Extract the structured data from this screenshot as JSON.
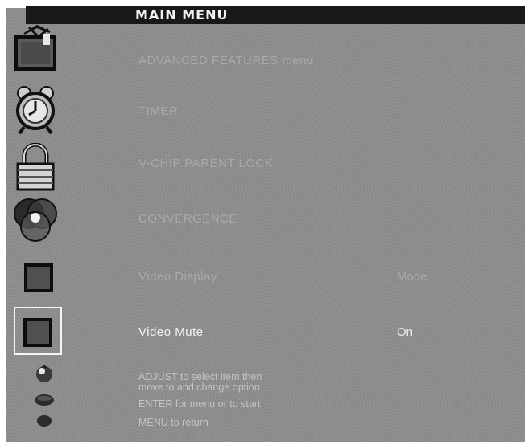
{
  "header": {
    "title": "MAIN MENU"
  },
  "menu": {
    "items": [
      {
        "label": "ADVANCED FEATURES menu",
        "icon": "tv-antenna-icon"
      },
      {
        "label": "TIMER",
        "icon": "alarm-clock-icon"
      },
      {
        "label": "V-CHIP PARENT LOCK",
        "icon": "padlock-icon"
      },
      {
        "label": "CONVERGENCE",
        "icon": "rgb-circles-icon"
      },
      {
        "label": "Video Display",
        "value": "Mode",
        "icon": "video-display-square-icon"
      },
      {
        "label": "Video Mute",
        "value": "On",
        "icon": "video-mute-square-icon",
        "selected": true
      }
    ]
  },
  "help": {
    "adjust_line1": "ADJUST to select item then",
    "adjust_line2": "move to and change option",
    "enter": "ENTER for menu or to start",
    "menu": "MENU to return"
  },
  "remote_icons": [
    "adjust-joystick-icon",
    "enter-button-icon",
    "menu-button-icon"
  ]
}
